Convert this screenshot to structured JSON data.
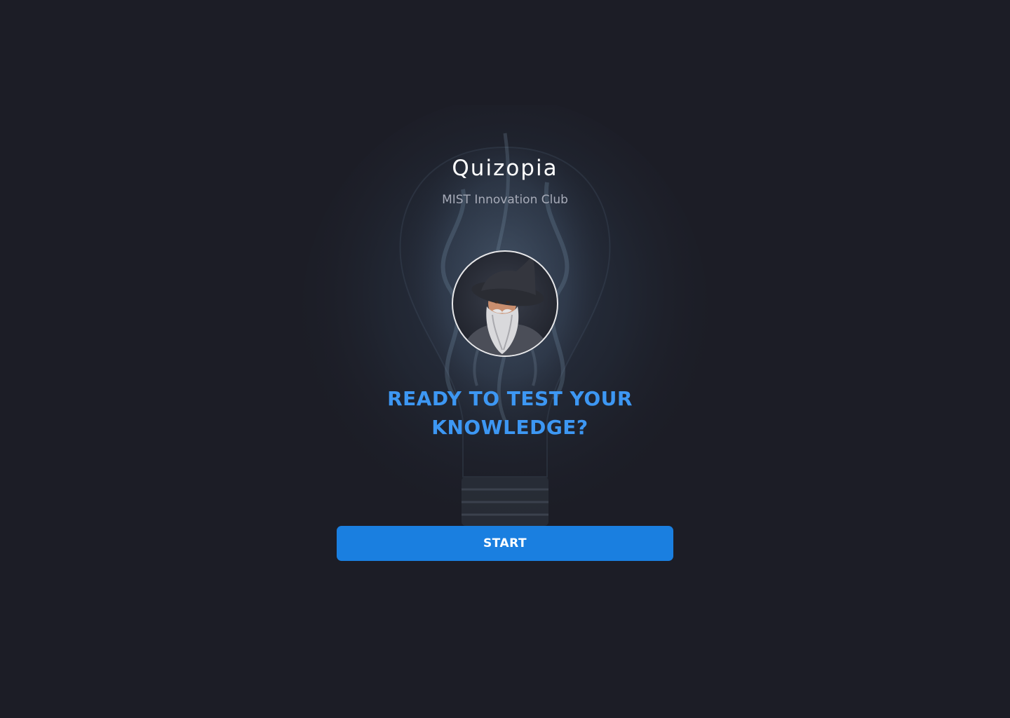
{
  "app": {
    "title": "Quizopia",
    "subtitle": "MIST Innovation Club"
  },
  "hero": {
    "avatar_icon": "wizard-icon",
    "background_icon": "smoky-lightbulb-icon",
    "headline": "READY TO TEST YOUR KNOWLEDGE?"
  },
  "actions": {
    "start_label": "START"
  },
  "colors": {
    "background": "#1c1d26",
    "accent": "#1a7fe0",
    "headline": "#3d97f3",
    "subtitle": "#a7abb8"
  }
}
